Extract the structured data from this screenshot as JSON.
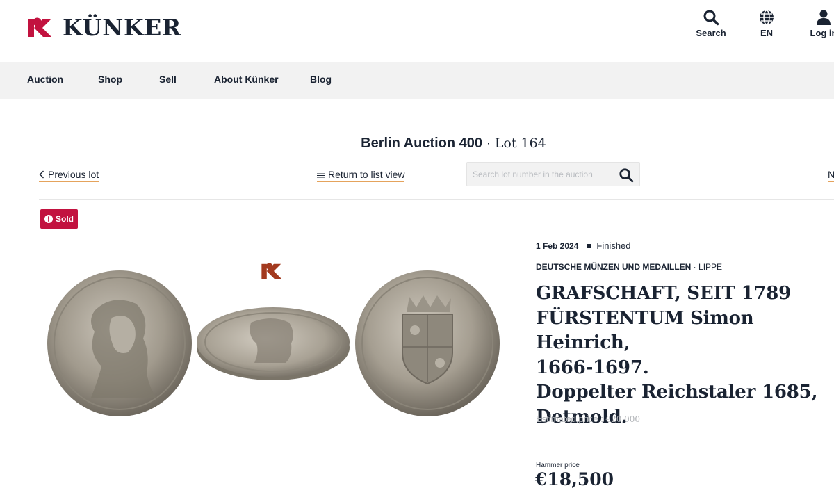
{
  "brand": {
    "name": "KÜNKER",
    "accent": "#c2123f"
  },
  "header_actions": [
    {
      "label": "Search",
      "icon": "search-icon"
    },
    {
      "label": "EN",
      "icon": "globe-icon"
    },
    {
      "label": "Log in",
      "icon": "user-icon"
    }
  ],
  "nav": {
    "items": [
      "Auction",
      "Shop",
      "Sell",
      "About Künker",
      "Blog"
    ]
  },
  "lot_header": {
    "auction": "Berlin Auction 400",
    "separator": " · ",
    "lot": "Lot 164"
  },
  "lot_navigation": {
    "previous": "Previous lot",
    "list_view": "Return to list view",
    "search_placeholder": "Search lot number in the auction",
    "next": "N"
  },
  "badge": {
    "label": "Sold",
    "color": "#c2123f"
  },
  "lot": {
    "date": "1 Feb 2024",
    "status": "Finished",
    "category_main": "DEUTSCHE MÜNZEN UND MEDAILLEN",
    "category_sep": " · ",
    "category_sub": "LIPPE",
    "title": "GRAFSCHAFT, SEIT 1789\nFÜRSTENTUM Simon Heinrich,\n1666-1697.\nDoppelter Reichstaler 1685,\nDetmold.",
    "estimate_label": "Estimated price : ",
    "estimate_value": "€20,000",
    "hammer_label": "Hammer price",
    "hammer_value": "€18,500"
  },
  "images": [
    {
      "name": "coin-obverse-image",
      "icon": "coin-obverse"
    },
    {
      "name": "coin-edge-image",
      "icon": "coin-tilted"
    },
    {
      "name": "coin-reverse-image",
      "icon": "coin-reverse"
    }
  ]
}
